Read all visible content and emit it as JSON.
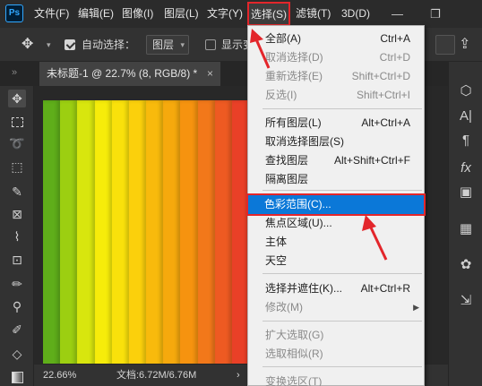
{
  "app": {
    "logo": "Ps"
  },
  "menubar": {
    "items": [
      "文件(F)",
      "编辑(E)",
      "图像(I)",
      "图层(L)",
      "文字(Y)",
      "选择(S)",
      "滤镜(T)",
      "3D(D)"
    ],
    "active": "选择(S)",
    "minimize": "—",
    "restore": "❐"
  },
  "options": {
    "move_icon": "move-tool-icon",
    "auto_select_label": "自动选择：",
    "auto_select_checked": true,
    "auto_select_value": "图层",
    "show_transform_label": "显示变"
  },
  "document_tab": {
    "title": "未标题-1 @ 22.7% (8, RGB/8) *",
    "close": "×"
  },
  "tabbar_collapse": "»",
  "status": {
    "zoom": "22.66%",
    "doc": "文档:6.72M/6.76M",
    "arrow": "›"
  },
  "artwork_colors": [
    "#5fae1a",
    "#9ccf11",
    "#d8e60e",
    "#f6ec0a",
    "#f9e10b",
    "#fbd00c",
    "#f8ba0c",
    "#f6a90d",
    "#f6930f",
    "#f2781a",
    "#ee5a22",
    "#e94027"
  ],
  "select_menu": {
    "items": [
      {
        "label": "全部(A)",
        "shortcut": "Ctrl+A",
        "enabled": true
      },
      {
        "label": "取消选择(D)",
        "shortcut": "Ctrl+D",
        "enabled": false
      },
      {
        "label": "重新选择(E)",
        "shortcut": "Shift+Ctrl+D",
        "enabled": false
      },
      {
        "label": "反选(I)",
        "shortcut": "Shift+Ctrl+I",
        "enabled": false
      },
      {
        "label": "所有图层(L)",
        "shortcut": "Alt+Ctrl+A",
        "enabled": true
      },
      {
        "label": "取消选择图层(S)",
        "shortcut": "",
        "enabled": true
      },
      {
        "label": "查找图层",
        "shortcut": "Alt+Shift+Ctrl+F",
        "enabled": true
      },
      {
        "label": "隔离图层",
        "shortcut": "",
        "enabled": true
      },
      {
        "label": "色彩范围(C)...",
        "shortcut": "",
        "enabled": true,
        "highlighted": true
      },
      {
        "label": "焦点区域(U)...",
        "shortcut": "",
        "enabled": true
      },
      {
        "label": "主体",
        "shortcut": "",
        "enabled": true
      },
      {
        "label": "天空",
        "shortcut": "",
        "enabled": true
      },
      {
        "label": "选择并遮住(K)...",
        "shortcut": "Alt+Ctrl+R",
        "enabled": true
      },
      {
        "label": "修改(M)",
        "shortcut": "",
        "enabled": false,
        "submenu": true
      },
      {
        "label": "扩大选取(G)",
        "shortcut": "",
        "enabled": false
      },
      {
        "label": "选取相似(R)",
        "shortcut": "",
        "enabled": false
      },
      {
        "label": "变换选区(T)",
        "shortcut": "",
        "enabled": false
      }
    ]
  },
  "colors": {
    "highlight": "#0b78d8",
    "annotation": "#e3262b"
  }
}
